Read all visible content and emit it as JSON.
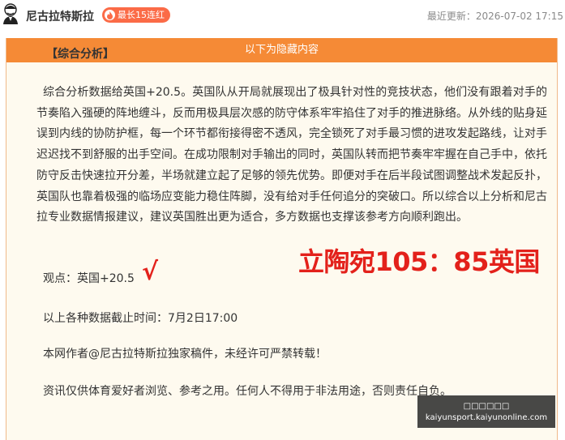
{
  "header": {
    "author": "尼古拉特斯拉",
    "badge": "最长15连红",
    "updated": "最近更新：2026-07-02 17:15"
  },
  "hidden": {
    "bar_label": "以下为隐藏内容"
  },
  "article": {
    "section_title": "【综合分析】",
    "paragraph": "综合分析数据给英国+20.5。英国队从开局就展现出了极具针对性的竞技状态，他们没有跟着对手的节奏陷入强硬的阵地缠斗，反而用极具层次感的防守体系牢牢掐住了对手的推进脉络。从外线的贴身延误到内线的协防护框，每一个环节都衔接得密不透风，完全锁死了对手最习惯的进攻发起路线，让对手迟迟找不到舒服的出手空间。在成功限制对手输出的同时，英国队转而把节奏牢牢握在自己手中，依托防守反击快速拉开分差，半场就建立起了足够的领先优势。即便对手在后半段试图调整战术发起反扑，英国队也靠着极强的临场应变能力稳住阵脚，没有给对手任何追分的突破口。所以综合以上分析和尼古拉专业数据情报建议，建议英国胜出更为适合，多方数据也支撑该参考方向顺利跑出。",
    "view": "观点：英国+20.5",
    "check": "√",
    "score": "立陶宛105：85英国",
    "deadline": "以上各种数据截止时间：7月2日17:00",
    "copyright": "本网作者@尼古拉特斯拉独家稿件，未经许可严禁转载！",
    "disclaimer": "资讯仅供体育爱好者浏览、参考之用。任何人不得用于非法用途，否则责任自负。"
  },
  "watermark": {
    "line1": "□□□□□□",
    "line2": "kaiyunsport.kaiyunonline.com"
  },
  "colors": {
    "accent_orange": "#f58a36",
    "badge_red": "#fb6b47",
    "highlight_red": "#e3211b",
    "box_bg": "#fefaef"
  },
  "icons": {
    "avatar": "tesla-portrait-icon",
    "badge": "flame-icon"
  }
}
